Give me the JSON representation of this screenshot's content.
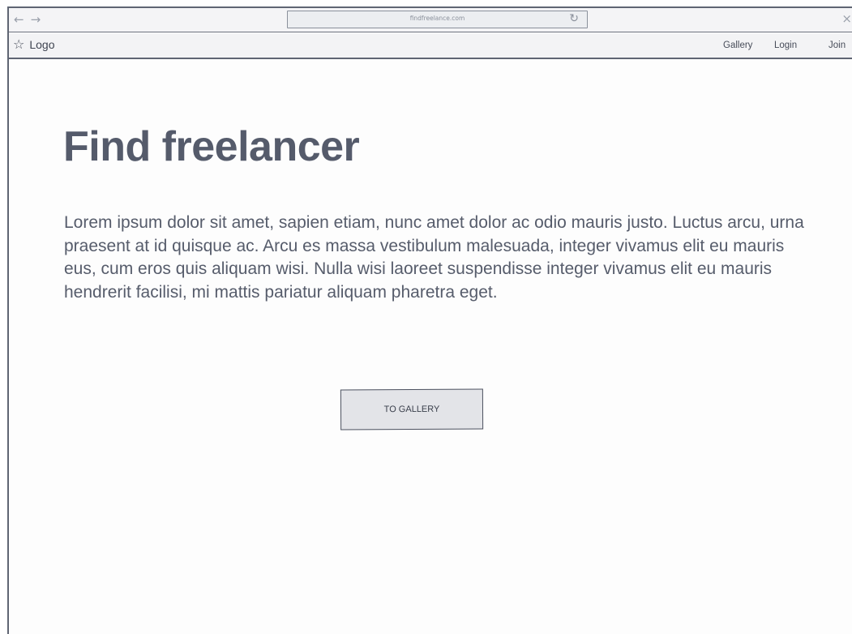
{
  "browser": {
    "back_icon": "←",
    "forward_icon": "→",
    "url": "findfreelance.com",
    "reload_icon": "↻",
    "close_icon": "×"
  },
  "header": {
    "star_icon": "☆",
    "logo_label": "Logo",
    "nav": [
      {
        "label": "Gallery"
      },
      {
        "label": "Login"
      },
      {
        "label": "Join"
      }
    ]
  },
  "main": {
    "title": "Find freelancer",
    "body": "Lorem ipsum dolor sit amet, sapien etiam, nunc amet dolor ac odio mauris justo. Luctus arcu, urna praesent at id quisque ac. Arcu es massa vestibulum malesuada, integer vivamus elit eu mauris eus, cum eros quis aliquam wisi. Nulla wisi laoreet suspendisse integer vivamus elit eu mauris hendrerit facilisi, mi mattis pariatur aliquam pharetra eget.",
    "button_label": "TO GALLERY"
  }
}
